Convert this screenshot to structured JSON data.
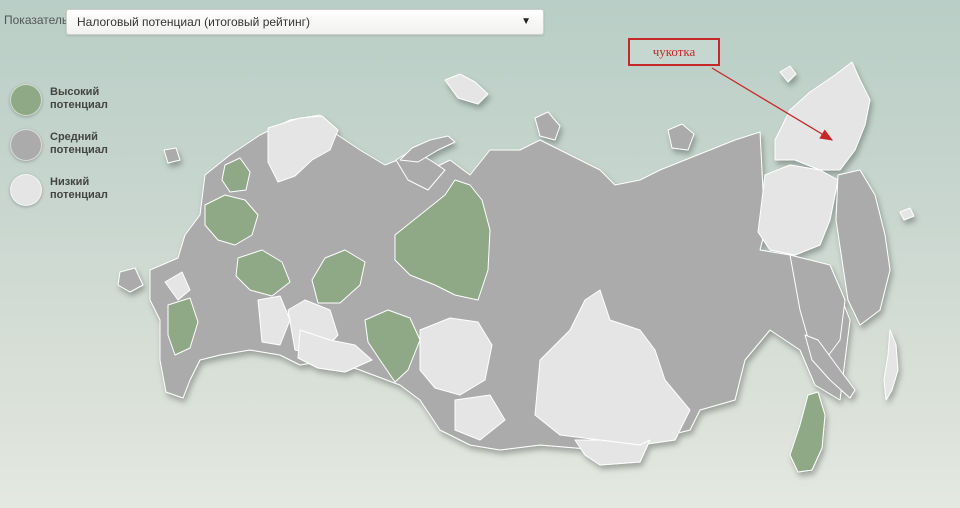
{
  "toolbar": {
    "indicator_label": "Показатель",
    "indicator_value": "Налоговый потенциал (итоговый рейтинг)",
    "dropdown_icon": "triangle-down-icon"
  },
  "legend": [
    {
      "label": "Высокий\nпотенциал",
      "color": "#8fa987"
    },
    {
      "label": "Средний\nпотенциал",
      "color": "#ababab"
    },
    {
      "label": "Низкий\nпотенциал",
      "color": "#e5e5e5"
    }
  ],
  "annotation": {
    "text": "чукотка",
    "color": "#c62828"
  },
  "colors": {
    "high": "#8fa987",
    "medium": "#ababab",
    "low": "#e5e5e5",
    "border": "#ffffff"
  }
}
